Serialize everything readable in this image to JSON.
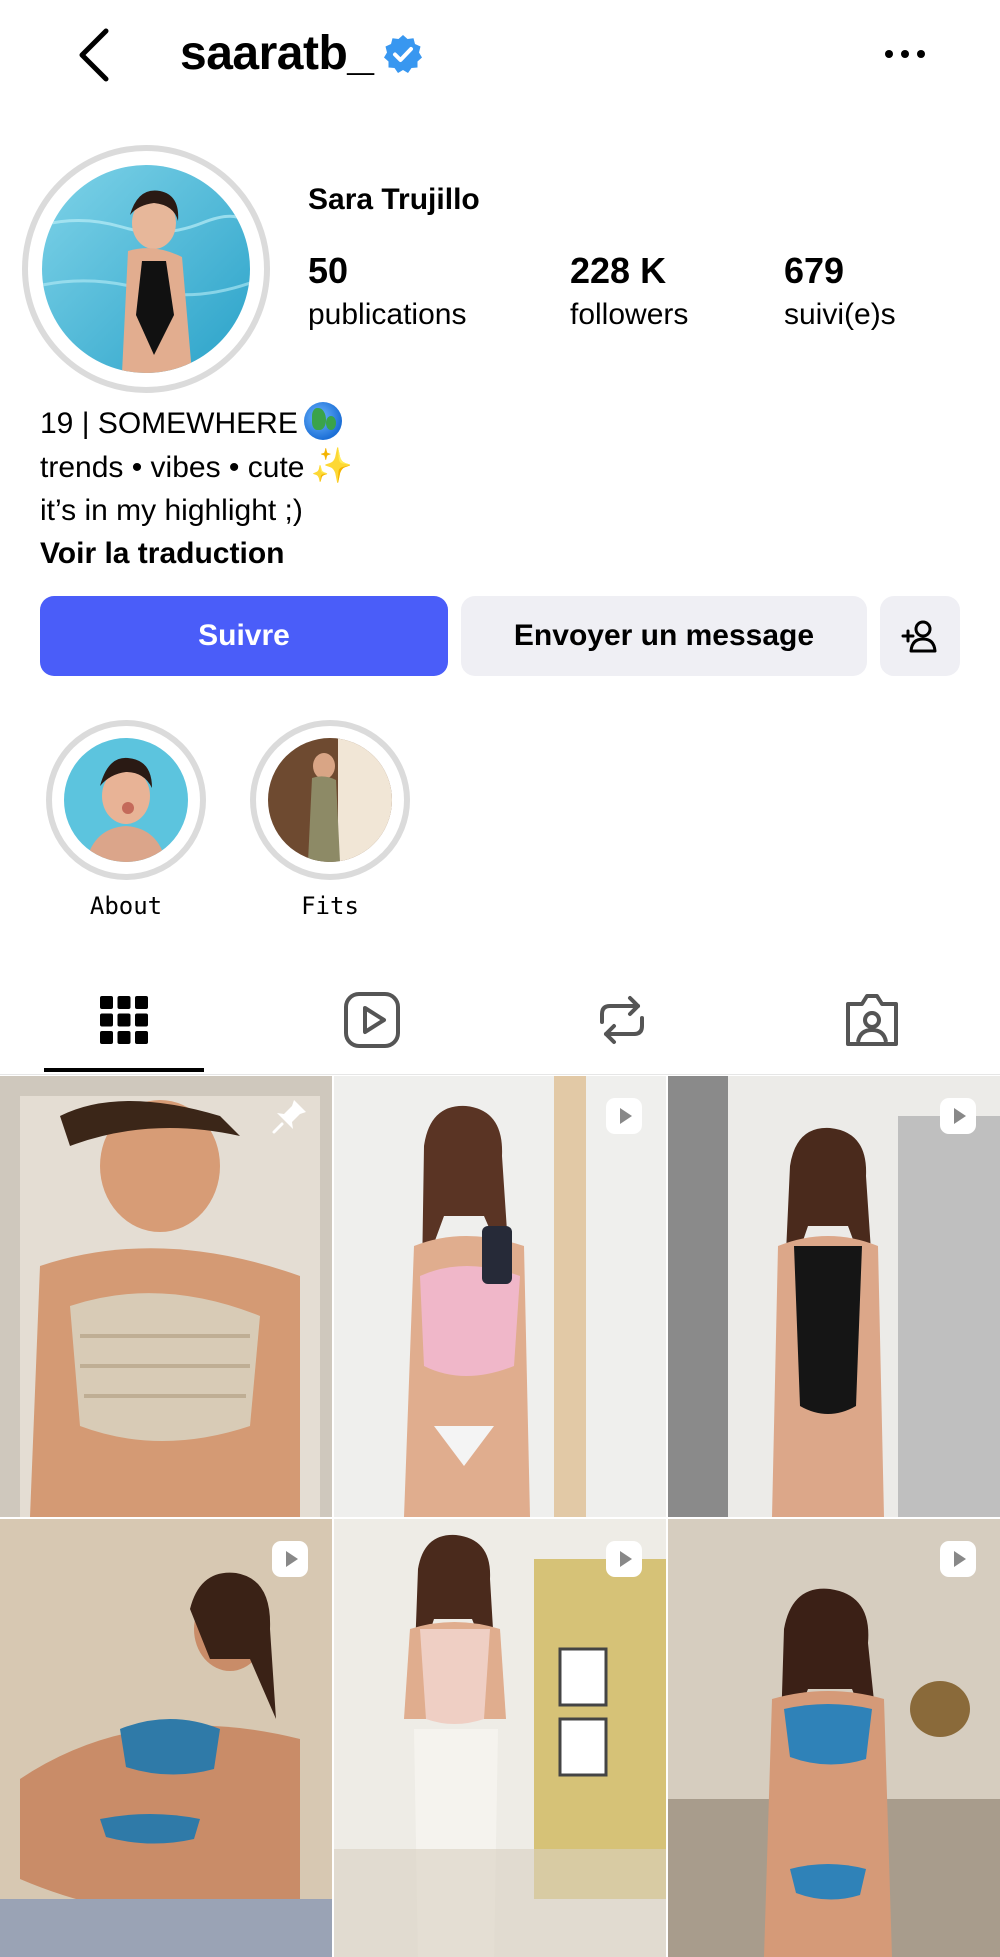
{
  "header": {
    "username": "saaratb_",
    "verified": true,
    "back_icon": "chevron-left-icon",
    "more_icon": "ellipsis-icon"
  },
  "profile": {
    "full_name": "Sara Trujillo",
    "stats": [
      {
        "value": "50",
        "label": "publications"
      },
      {
        "value": "228 K",
        "label": "followers"
      },
      {
        "value": "679",
        "label": "suivi(e)s"
      }
    ],
    "bio": {
      "line1": "19 | SOMEWHERE",
      "line2": "trends • vibes • cute",
      "line3": "it’s in my highlight ;)",
      "translate": "Voir la traduction"
    }
  },
  "actions": {
    "follow": "Suivre",
    "message": "Envoyer un message",
    "add_icon": "add-person-icon"
  },
  "highlights": [
    {
      "label": "About"
    },
    {
      "label": "Fits"
    }
  ],
  "tabs": [
    {
      "icon": "grid-icon",
      "active": true
    },
    {
      "icon": "reels-icon",
      "active": false
    },
    {
      "icon": "repost-icon",
      "active": false
    },
    {
      "icon": "tagged-icon",
      "active": false
    }
  ],
  "grid": [
    {
      "badge": "pin-icon"
    },
    {
      "badge": "reel-icon"
    },
    {
      "badge": "reel-icon"
    },
    {
      "badge": "reel-icon"
    },
    {
      "badge": "reel-icon"
    },
    {
      "badge": "reel-icon"
    }
  ],
  "colors": {
    "accent": "#4a5df9",
    "verified": "#3897f0",
    "secondary_button": "#efeff4",
    "ring": "#dbdbdb"
  }
}
